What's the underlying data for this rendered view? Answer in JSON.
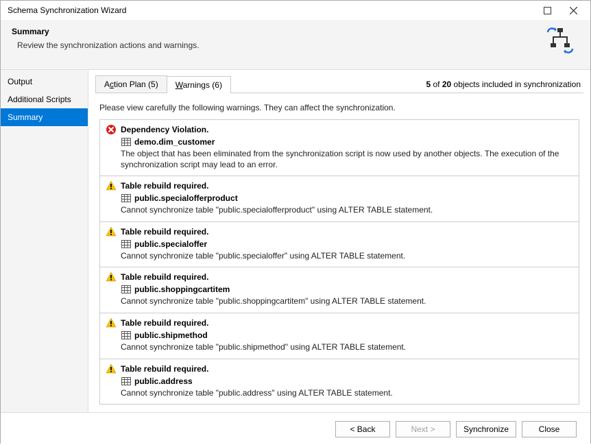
{
  "window": {
    "title": "Schema Synchronization Wizard"
  },
  "header": {
    "title": "Summary",
    "description": "Review the synchronization actions and warnings."
  },
  "sidebar": {
    "items": [
      {
        "label": "Output",
        "selected": false
      },
      {
        "label": "Additional Scripts",
        "selected": false
      },
      {
        "label": "Summary",
        "selected": true
      }
    ]
  },
  "tabs": {
    "action_plan": {
      "prefix": "A",
      "under": "c",
      "rest": "tion Plan (5)"
    },
    "warnings": {
      "prefix": "",
      "under": "W",
      "rest": "arnings (6)"
    }
  },
  "status": {
    "count": "5",
    "total": "20",
    "text_mid": " of ",
    "text_end": " objects included in synchronization"
  },
  "instruction": "Please view carefully the following warnings. They can affect the synchronization.",
  "warnings": [
    {
      "severity": "error",
      "title": "Dependency Violation.",
      "object": "demo.dim_customer",
      "desc": "The object that has been eliminated from the synchronization script is now used by another objects. The execution of the synchronization script may lead to an error."
    },
    {
      "severity": "warn",
      "title": "Table rebuild required.",
      "object": "public.specialofferproduct",
      "desc": "Cannot synchronize table \"public.specialofferproduct\" using ALTER TABLE statement."
    },
    {
      "severity": "warn",
      "title": "Table rebuild required.",
      "object": "public.specialoffer",
      "desc": "Cannot synchronize table \"public.specialoffer\" using ALTER TABLE statement."
    },
    {
      "severity": "warn",
      "title": "Table rebuild required.",
      "object": "public.shoppingcartitem",
      "desc": "Cannot synchronize table \"public.shoppingcartitem\" using ALTER TABLE statement."
    },
    {
      "severity": "warn",
      "title": "Table rebuild required.",
      "object": "public.shipmethod",
      "desc": "Cannot synchronize table \"public.shipmethod\" using ALTER TABLE statement."
    },
    {
      "severity": "warn",
      "title": "Table rebuild required.",
      "object": "public.address",
      "desc": "Cannot synchronize table \"public.address\" using ALTER TABLE statement."
    }
  ],
  "buttons": {
    "back": "< Back",
    "next": "Next >",
    "sync": "Synchronize",
    "close": "Close"
  }
}
